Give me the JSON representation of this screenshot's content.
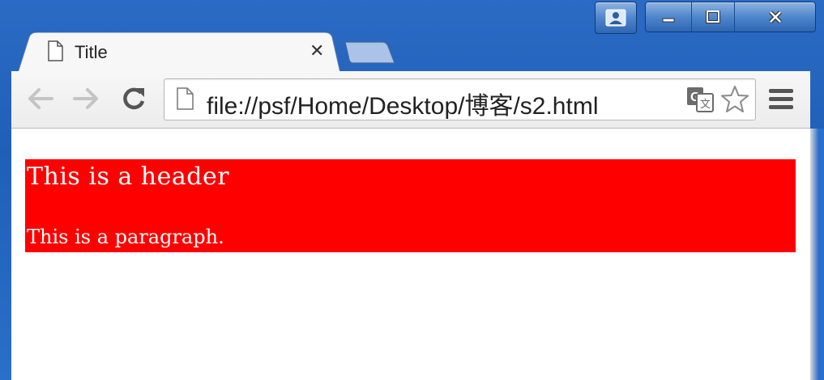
{
  "browser": {
    "tab": {
      "title": "Title",
      "close_glyph": "✕"
    },
    "address": {
      "url": "file://psf/Home/Desktop/博客/s2.html"
    },
    "icons": {
      "back": "back-arrow-icon",
      "forward": "forward-arrow-icon",
      "reload": "reload-icon",
      "page": "page-icon",
      "translate": "translate-icon",
      "bookmark": "star-icon",
      "menu": "hamburger-menu-icon"
    },
    "window_controls": [
      "minimize",
      "maximize",
      "close"
    ]
  },
  "page": {
    "header": "This is a header",
    "paragraph": "This is a paragraph.",
    "box_color": "#ff0000",
    "text_color": "#ffffff"
  }
}
